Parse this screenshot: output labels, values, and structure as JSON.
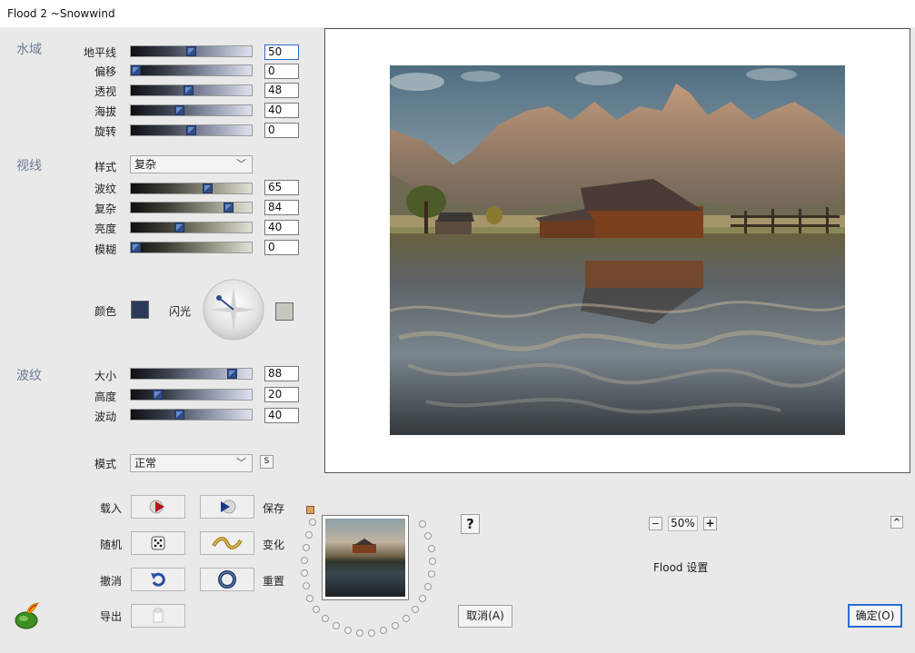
{
  "window": {
    "title": "Flood 2 ~Snowwind"
  },
  "sections": {
    "water": "水域",
    "view": "视线",
    "waves": "波纹"
  },
  "water": {
    "horizon": {
      "label": "地平线",
      "value": "50",
      "level": 50
    },
    "offset": {
      "label": "偏移",
      "value": "0",
      "level": 0
    },
    "perspective": {
      "label": "透视",
      "value": "48",
      "level": 48
    },
    "altitude": {
      "label": "海拔",
      "value": "40",
      "level": 40
    },
    "rotation": {
      "label": "旋转",
      "value": "0",
      "level": 50
    }
  },
  "view": {
    "style": {
      "label": "样式",
      "value": "复杂"
    },
    "waviness": {
      "label": "波纹",
      "value": "65",
      "level": 65
    },
    "complexity": {
      "label": "复杂",
      "value": "84",
      "level": 84
    },
    "brightness": {
      "label": "亮度",
      "value": "40",
      "level": 40
    },
    "blur": {
      "label": "模糊",
      "value": "0",
      "level": 0
    },
    "color": {
      "label": "颜色",
      "value": "#2a3b5a"
    },
    "glint": {
      "label": "闪光",
      "value": "#c7c7c0"
    }
  },
  "waves": {
    "size": {
      "label": "大小",
      "value": "88",
      "level": 88
    },
    "height": {
      "label": "高度",
      "value": "20",
      "level": 20
    },
    "undulation": {
      "label": "波动",
      "value": "40",
      "level": 40
    }
  },
  "mode": {
    "label": "模式",
    "value": "正常",
    "extra": "S"
  },
  "actions": {
    "load": "载入",
    "save": "保存",
    "random": "随机",
    "change": "变化",
    "undo": "撤消",
    "reset": "重置",
    "export": "导出"
  },
  "preview": {
    "zoom": "50%",
    "zoom_out": "−",
    "zoom_in": "+",
    "help": "?",
    "collapse": "^",
    "status": "Flood 设置"
  },
  "buttons": {
    "cancel": "取消(A)",
    "ok": "确定(O)"
  },
  "colors": {
    "section_label": "#6d7c96",
    "thumb": "#2f4d86",
    "ok_border": "#2b6cd0"
  }
}
